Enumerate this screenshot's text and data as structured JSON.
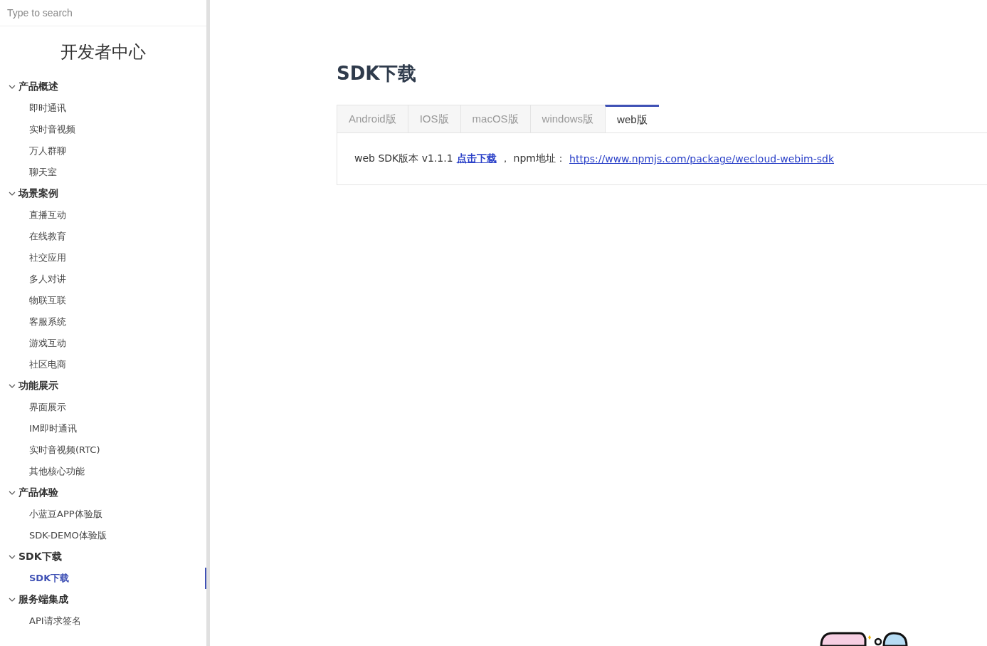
{
  "sidebar": {
    "search": {
      "placeholder": "Type to search"
    },
    "title": "开发者中心",
    "groups": [
      {
        "label": "产品概述",
        "expanded": true,
        "children": [
          {
            "label": "即时通讯",
            "selected": false
          },
          {
            "label": "实时音视频",
            "selected": false
          },
          {
            "label": "万人群聊",
            "selected": false
          },
          {
            "label": "聊天室",
            "selected": false
          }
        ]
      },
      {
        "label": "场景案例",
        "expanded": true,
        "children": [
          {
            "label": "直播互动",
            "selected": false
          },
          {
            "label": "在线教育",
            "selected": false
          },
          {
            "label": "社交应用",
            "selected": false
          },
          {
            "label": "多人对讲",
            "selected": false
          },
          {
            "label": "物联互联",
            "selected": false
          },
          {
            "label": "客服系统",
            "selected": false
          },
          {
            "label": "游戏互动",
            "selected": false
          },
          {
            "label": "社区电商",
            "selected": false
          }
        ]
      },
      {
        "label": "功能展示",
        "expanded": true,
        "children": [
          {
            "label": "界面展示",
            "selected": false
          },
          {
            "label": "IM即时通讯",
            "selected": false
          },
          {
            "label": "实时音视频(RTC)",
            "selected": false
          },
          {
            "label": "其他核心功能",
            "selected": false
          }
        ]
      },
      {
        "label": "产品体验",
        "expanded": true,
        "children": [
          {
            "label": "小蓝豆APP体验版",
            "selected": false
          },
          {
            "label": "SDK-DEMO体验版",
            "selected": false
          }
        ]
      },
      {
        "label": "SDK下载",
        "expanded": true,
        "children": [
          {
            "label": "SDK下载",
            "selected": true
          }
        ]
      },
      {
        "label": "服务端集成",
        "expanded": true,
        "children": [
          {
            "label": "API请求签名",
            "selected": false
          }
        ]
      }
    ]
  },
  "main": {
    "title": "SDK下载",
    "tabs": [
      {
        "label": "Android版",
        "selected": false
      },
      {
        "label": "IOS版",
        "selected": false
      },
      {
        "label": "macOS版",
        "selected": false
      },
      {
        "label": "windows版",
        "selected": false
      },
      {
        "label": "web版",
        "selected": true
      }
    ],
    "content": {
      "text": "web SDK版本 v1.1.1",
      "download_link": "点击下载",
      "separator": "，",
      "npm_label": "npm地址：",
      "npm_link": "https://www.npmjs.com/package/wecloud-webim-sdk"
    }
  }
}
